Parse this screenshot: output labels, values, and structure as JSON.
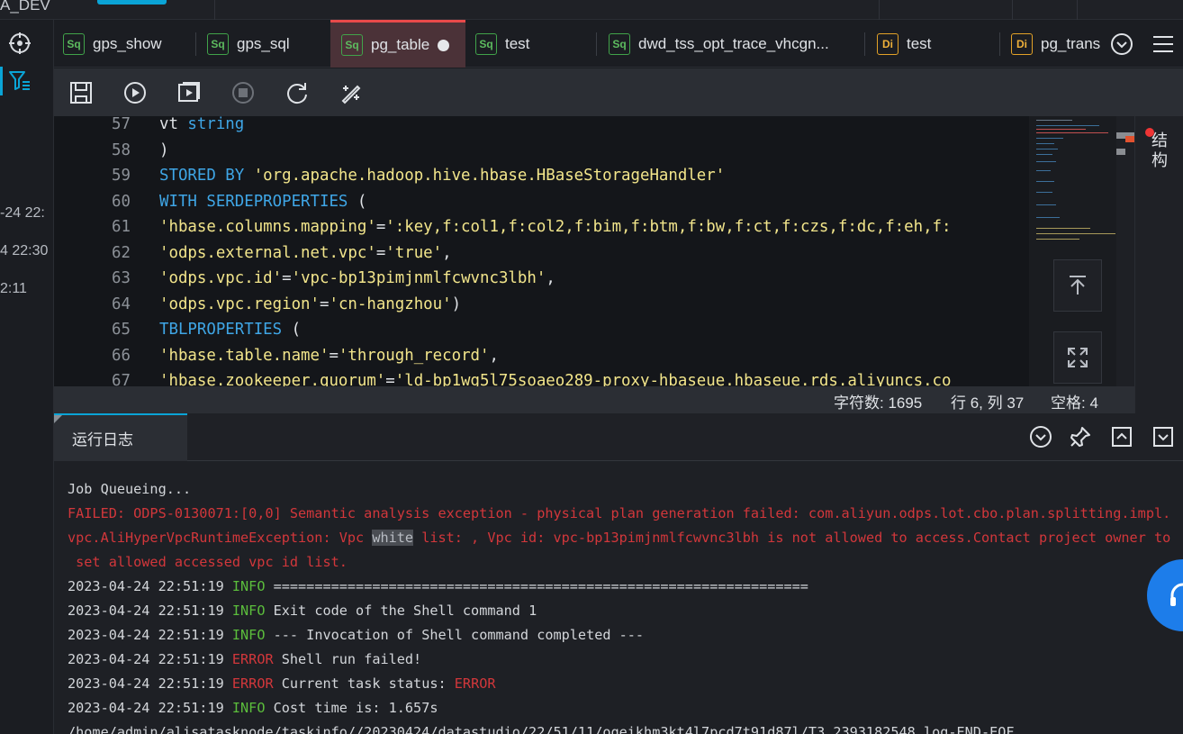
{
  "topbar": {
    "project": "A_DEV"
  },
  "left_rail": {
    "times": [
      "-24 22:",
      "4 22:30",
      "2:11"
    ]
  },
  "tabs": [
    {
      "label": "gps_show",
      "badge": "Sq",
      "type": "sql"
    },
    {
      "label": "gps_sql",
      "badge": "Sq",
      "type": "sql"
    },
    {
      "label": "pg_table",
      "badge": "Sq",
      "type": "sql",
      "active": true,
      "unsaved": true
    },
    {
      "label": "test",
      "badge": "Sq",
      "type": "sql"
    },
    {
      "label": "dwd_tss_opt_trace_vhcgn...",
      "badge": "Sq",
      "type": "sql"
    },
    {
      "label": "test",
      "badge": "Di",
      "type": "di"
    },
    {
      "label": "pg_trans",
      "badge": "Di",
      "type": "di"
    }
  ],
  "toolbar": {
    "icons": [
      "save-icon",
      "run-icon",
      "run-with-params-icon",
      "stop-icon",
      "refresh-icon",
      "format-icon"
    ]
  },
  "editor": {
    "lines": [
      {
        "num": "57",
        "tokens": [
          {
            "t": "pl",
            "v": "vt "
          },
          {
            "t": "kw",
            "v": "string"
          }
        ]
      },
      {
        "num": "58",
        "tokens": [
          {
            "t": "pl",
            "v": ")"
          }
        ]
      },
      {
        "num": "59",
        "tokens": [
          {
            "t": "kw",
            "v": "STORED BY "
          },
          {
            "t": "str",
            "v": "'org.apache.hadoop.hive.hbase.HBaseStorageHandler'"
          }
        ]
      },
      {
        "num": "60",
        "tokens": [
          {
            "t": "kw",
            "v": "WITH SERDEPROPERTIES "
          },
          {
            "t": "pl",
            "v": "("
          }
        ]
      },
      {
        "num": "61",
        "tokens": [
          {
            "t": "str",
            "v": "'hbase.columns.mapping'"
          },
          {
            "t": "pl",
            "v": "="
          },
          {
            "t": "str",
            "v": "':key,f:col1,f:col2,f:bim,f:btm,f:bw,f:ct,f:czs,f:dc,f:eh,f:"
          }
        ]
      },
      {
        "num": "62",
        "tokens": [
          {
            "t": "str",
            "v": "'odps.external.net.vpc'"
          },
          {
            "t": "pl",
            "v": "="
          },
          {
            "t": "str",
            "v": "'true'"
          },
          {
            "t": "pl",
            "v": ","
          }
        ]
      },
      {
        "num": "63",
        "tokens": [
          {
            "t": "str",
            "v": "'odps.vpc.id'"
          },
          {
            "t": "pl",
            "v": "="
          },
          {
            "t": "str",
            "v": "'vpc-bp13pimjnmlfcwvnc3lbh'"
          },
          {
            "t": "pl",
            "v": ","
          }
        ]
      },
      {
        "num": "64",
        "tokens": [
          {
            "t": "str",
            "v": "'odps.vpc.region'"
          },
          {
            "t": "pl",
            "v": "="
          },
          {
            "t": "str",
            "v": "'cn-hangzhou'"
          },
          {
            "t": "pl",
            "v": ")"
          }
        ]
      },
      {
        "num": "65",
        "tokens": [
          {
            "t": "kw",
            "v": "TBLPROPERTIES "
          },
          {
            "t": "pl",
            "v": "("
          }
        ]
      },
      {
        "num": "66",
        "tokens": [
          {
            "t": "str",
            "v": "'hbase.table.name'"
          },
          {
            "t": "pl",
            "v": "="
          },
          {
            "t": "str",
            "v": "'through_record'"
          },
          {
            "t": "pl",
            "v": ","
          }
        ]
      },
      {
        "num": "67",
        "tokens": [
          {
            "t": "str",
            "v": "'hbase.zookeeper.quorum'"
          },
          {
            "t": "pl",
            "v": "="
          },
          {
            "t": "str",
            "v": "'ld-bp1wg5l75soaeo289-proxy-hbaseue.hbaseue.rds.aliyuncs.co"
          }
        ]
      }
    ]
  },
  "structure_panel": {
    "label": "结构"
  },
  "statusbar": {
    "chars": "字符数: 1695",
    "position": "行 6, 列 37",
    "indent": "空格: 4"
  },
  "log": {
    "tab_label": "运行日志",
    "lines": [
      {
        "kind": "plain",
        "text": "Job Queueing..."
      },
      {
        "kind": "err",
        "text": "FAILED: ODPS-0130071:[0,0] Semantic analysis exception - physical plan generation failed: com.aliyun.odps.lot.cbo.plan.splitting.impl."
      },
      {
        "kind": "err-hl",
        "before": "vpc.AliHyperVpcRuntimeException: Vpc ",
        "highlight": "white",
        "after": " list: , Vpc id: vpc-bp13pimjnmlfcwvnc3lbh is not allowed to access.Contact project owner to"
      },
      {
        "kind": "err",
        "text": " set allowed accessed vpc id list."
      },
      {
        "kind": "level",
        "ts": "2023-04-24 22:51:19",
        "level": "INFO",
        "msg": " ================================================================="
      },
      {
        "kind": "level",
        "ts": "2023-04-24 22:51:19",
        "level": "INFO",
        "msg": " Exit code of the Shell command 1"
      },
      {
        "kind": "level",
        "ts": "2023-04-24 22:51:19",
        "level": "INFO",
        "msg": " --- Invocation of Shell command completed ---"
      },
      {
        "kind": "level",
        "ts": "2023-04-24 22:51:19",
        "level": "ERROR",
        "msg": " Shell run failed!"
      },
      {
        "kind": "level2",
        "ts": "2023-04-24 22:51:19",
        "level": "ERROR",
        "msg": " Current task status: ",
        "tail": "ERROR"
      },
      {
        "kind": "level",
        "ts": "2023-04-24 22:51:19",
        "level": "INFO",
        "msg": " Cost time is: 1.657s"
      },
      {
        "kind": "plain",
        "text": "/home/admin/alisatasknode/taskinfo//20230424/datastudio/22/51/11/oqeikhm3kt4l7pcd7t91d87l/T3_2393182548.log-END-EOF"
      }
    ]
  },
  "colors": {
    "keyword": "#3fa6e6",
    "string": "#f2e58b",
    "info": "#5bbd3c",
    "error": "#d2373b",
    "accent": "#0aa4d6",
    "active_tab_border": "#e84a4a"
  }
}
